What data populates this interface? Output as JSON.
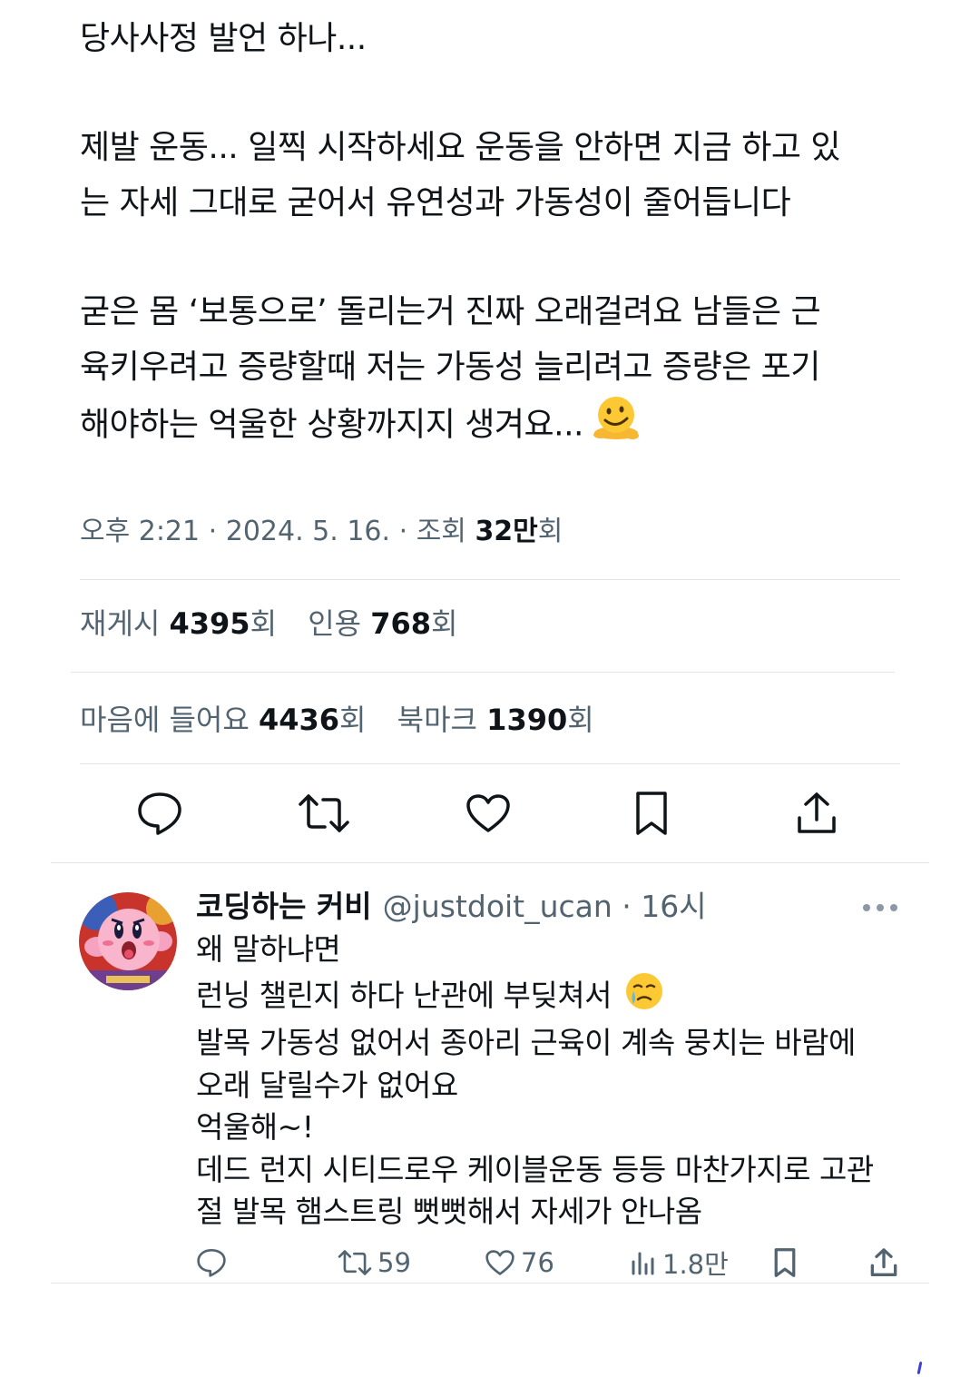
{
  "tweet": {
    "lines": {
      "l1": "당사사정 발언 하나...",
      "l2": "제발 운동... 일찍 시작하세요 운동을 안하면 지금 하고 있",
      "l3": "는 자세 그대로 굳어서 유연성과 가동성이 줄어듭니다",
      "l4": "굳은 몸 ‘보통으로’ 돌리는거 진짜 오래걸려요 남들은 근",
      "l5": "육키우려고 증량할때 저는 가동성 늘리려고 증량은 포기",
      "l6": "해야하는 억울한 상황까지지 생겨요..."
    },
    "emoji": "melting-face-emoji",
    "time": "오후 2:21",
    "date": "2024. 5. 16.",
    "views_label": "조회",
    "views_count": "32만",
    "suffix": "회",
    "sep": "·"
  },
  "stats": {
    "repost_label": "재게시",
    "repost_count": "4395",
    "quote_label": "인용",
    "quote_count": "768",
    "like_label": "마음에 들어요",
    "like_count": "4436",
    "bookmark_label": "북마크",
    "bookmark_count": "1390",
    "suffix": "회"
  },
  "actions": [
    "reply-icon",
    "repost-icon",
    "like-icon",
    "bookmark-icon",
    "share-icon"
  ],
  "reply": {
    "name": "코딩하는 커비",
    "handle": "@justdoit_ucan · 16시",
    "avatar": "kirby-avatar",
    "lines": {
      "l1": "왜 말하냐면",
      "l2": "런닝 챌린지 하다 난관에 부딪쳐서",
      "l3": "발목 가동성 없어서 종아리 근육이 계속 뭉치는 바람에",
      "l4": "오래 달릴수가 없어요",
      "l5": "억울해~!",
      "l6": "데드 런지 시티드로우 케이블운동 등등 마찬가지로 고관",
      "l7": "절 발목 햄스트링 뻣뻣해서 자세가 안나옴"
    },
    "emoji": "crying-face-emoji",
    "repost_count": "59",
    "like_count": "76",
    "views_count": "1.8만"
  },
  "colors": {
    "text": "#0f1419",
    "secondary": "#536471",
    "divider": "#e1e5e8"
  }
}
